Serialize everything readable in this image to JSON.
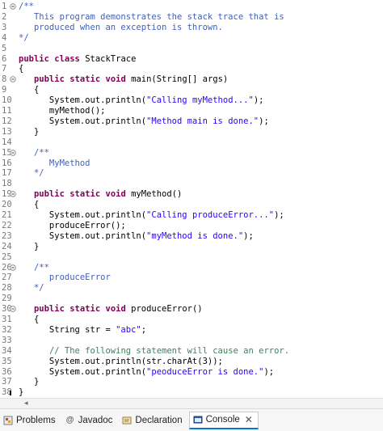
{
  "editor": {
    "lines": [
      {
        "n": "1",
        "fold": "minus",
        "segs": [
          {
            "t": "/**",
            "c": "doc"
          }
        ]
      },
      {
        "n": "2",
        "segs": [
          {
            "t": "   This program demonstrates the stack trace that is",
            "c": "doc"
          }
        ]
      },
      {
        "n": "3",
        "segs": [
          {
            "t": "   produced when an exception is thrown.",
            "c": "doc"
          }
        ]
      },
      {
        "n": "4",
        "segs": [
          {
            "t": "*/",
            "c": "doc"
          }
        ]
      },
      {
        "n": "5",
        "segs": []
      },
      {
        "n": "6",
        "segs": [
          {
            "t": "public",
            "c": "kw"
          },
          {
            "t": " "
          },
          {
            "t": "class",
            "c": "kw"
          },
          {
            "t": " StackTrace"
          }
        ]
      },
      {
        "n": "7",
        "segs": [
          {
            "t": "{"
          }
        ]
      },
      {
        "n": "8",
        "fold": "minus",
        "segs": [
          {
            "t": "   "
          },
          {
            "t": "public",
            "c": "kw"
          },
          {
            "t": " "
          },
          {
            "t": "static",
            "c": "kw"
          },
          {
            "t": " "
          },
          {
            "t": "void",
            "c": "kw"
          },
          {
            "t": " main(String[] args)"
          }
        ]
      },
      {
        "n": "9",
        "segs": [
          {
            "t": "   {"
          }
        ]
      },
      {
        "n": "10",
        "segs": [
          {
            "t": "      System.out.println("
          },
          {
            "t": "\"Calling myMethod...\"",
            "c": "str"
          },
          {
            "t": ");"
          }
        ]
      },
      {
        "n": "11",
        "segs": [
          {
            "t": "      myMethod();"
          }
        ]
      },
      {
        "n": "12",
        "segs": [
          {
            "t": "      System.out.println("
          },
          {
            "t": "\"Method main is done.\"",
            "c": "str"
          },
          {
            "t": ");"
          }
        ]
      },
      {
        "n": "13",
        "segs": [
          {
            "t": "   }"
          }
        ]
      },
      {
        "n": "14",
        "segs": []
      },
      {
        "n": "15",
        "fold": "minus",
        "segs": [
          {
            "t": "   "
          },
          {
            "t": "/**",
            "c": "doc"
          }
        ]
      },
      {
        "n": "16",
        "segs": [
          {
            "t": "      MyMethod",
            "c": "doc"
          }
        ]
      },
      {
        "n": "17",
        "segs": [
          {
            "t": "   */",
            "c": "doc"
          }
        ]
      },
      {
        "n": "18",
        "segs": []
      },
      {
        "n": "19",
        "fold": "minus",
        "segs": [
          {
            "t": "   "
          },
          {
            "t": "public",
            "c": "kw"
          },
          {
            "t": " "
          },
          {
            "t": "static",
            "c": "kw"
          },
          {
            "t": " "
          },
          {
            "t": "void",
            "c": "kw"
          },
          {
            "t": " myMethod()"
          }
        ]
      },
      {
        "n": "20",
        "segs": [
          {
            "t": "   {"
          }
        ]
      },
      {
        "n": "21",
        "segs": [
          {
            "t": "      System.out.println("
          },
          {
            "t": "\"Calling produceError...\"",
            "c": "str"
          },
          {
            "t": ");"
          }
        ]
      },
      {
        "n": "22",
        "segs": [
          {
            "t": "      produceError();"
          }
        ]
      },
      {
        "n": "23",
        "segs": [
          {
            "t": "      System.out.println("
          },
          {
            "t": "\"myMethod is done.\"",
            "c": "str"
          },
          {
            "t": ");"
          }
        ]
      },
      {
        "n": "24",
        "segs": [
          {
            "t": "   }"
          }
        ]
      },
      {
        "n": "25",
        "segs": []
      },
      {
        "n": "26",
        "fold": "minus",
        "segs": [
          {
            "t": "   "
          },
          {
            "t": "/**",
            "c": "doc"
          }
        ]
      },
      {
        "n": "27",
        "segs": [
          {
            "t": "      produceError",
            "c": "doc"
          }
        ]
      },
      {
        "n": "28",
        "segs": [
          {
            "t": "   */",
            "c": "doc"
          }
        ]
      },
      {
        "n": "29",
        "segs": []
      },
      {
        "n": "30",
        "fold": "minus",
        "segs": [
          {
            "t": "   "
          },
          {
            "t": "public",
            "c": "kw"
          },
          {
            "t": " "
          },
          {
            "t": "static",
            "c": "kw"
          },
          {
            "t": " "
          },
          {
            "t": "void",
            "c": "kw"
          },
          {
            "t": " produceError()"
          }
        ]
      },
      {
        "n": "31",
        "segs": [
          {
            "t": "   {"
          }
        ]
      },
      {
        "n": "32",
        "segs": [
          {
            "t": "      String str = "
          },
          {
            "t": "\"abc\"",
            "c": "str"
          },
          {
            "t": ";"
          }
        ]
      },
      {
        "n": "33",
        "segs": []
      },
      {
        "n": "34",
        "segs": [
          {
            "t": "      "
          },
          {
            "t": "// The following statement will cause an error.",
            "c": "cmt"
          }
        ]
      },
      {
        "n": "35",
        "segs": [
          {
            "t": "      System.out.println(str.charAt(3));"
          }
        ]
      },
      {
        "n": "36",
        "segs": [
          {
            "t": "      System.out.println("
          },
          {
            "t": "\"peoduceError is done.\"",
            "c": "str"
          },
          {
            "t": ");"
          }
        ]
      },
      {
        "n": "37",
        "segs": [
          {
            "t": "   }"
          }
        ]
      },
      {
        "n": "38",
        "segs": [
          {
            "t": "}"
          }
        ]
      }
    ]
  },
  "scrollbar": {
    "left_arrow": "◂"
  },
  "bottom_tabs": [
    {
      "label": "Problems",
      "icon": "problems-icon",
      "active": false
    },
    {
      "label": "Javadoc",
      "icon": "javadoc-icon",
      "active": false
    },
    {
      "label": "Declaration",
      "icon": "declaration-icon",
      "active": false
    },
    {
      "label": "Console",
      "icon": "console-icon",
      "active": true,
      "close": "✕"
    }
  ]
}
